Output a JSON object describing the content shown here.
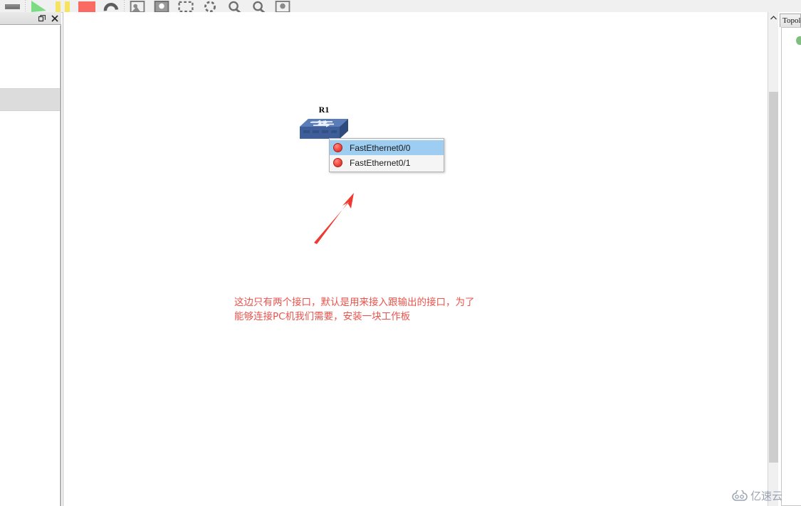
{
  "toolbar": {
    "buttons": [
      {
        "name": "minimize-icon",
        "icon": "minus-icon"
      },
      {
        "name": "start-button",
        "icon": "play-icon",
        "color": "#7ddb84"
      },
      {
        "name": "pause-button",
        "icon": "pause-icon",
        "color": "#f7e45e"
      },
      {
        "name": "stop-button",
        "icon": "stop-icon",
        "color": "#f96b62"
      },
      {
        "name": "reload-button",
        "icon": "reload-icon",
        "color": "#5d5d5d"
      },
      {
        "name": "screenshot-button",
        "icon": "image-icon"
      },
      {
        "name": "capture-button",
        "icon": "camera-icon"
      },
      {
        "name": "select-region-button",
        "icon": "dashed-rect-icon"
      },
      {
        "name": "lasso-button",
        "icon": "dashed-circle-icon"
      },
      {
        "name": "zoom-in-button",
        "icon": "magnifier-plus-icon"
      },
      {
        "name": "zoom-out-button",
        "icon": "magnifier-minus-icon"
      },
      {
        "name": "save-image-button",
        "icon": "save-image-icon"
      }
    ]
  },
  "left_panel": {
    "float_label": "❐",
    "close_label": "✕"
  },
  "canvas": {
    "device": {
      "label": "R1",
      "type": "router"
    },
    "context_menu": {
      "items": [
        {
          "label": "FastEthernet0/0",
          "selected": true,
          "status_color": "#f4534a"
        },
        {
          "label": "FastEthernet0/1",
          "selected": false,
          "status_color": "#f4534a"
        }
      ]
    },
    "annotation": {
      "arrow_color": "#ee3a30",
      "note_color": "#e8534c",
      "note_text": "这边只有两个接口，默认是用来接入跟输出的接口，为了\n能够连接PC机我们需要，安装一块工作板"
    }
  },
  "scrollbar": {
    "up_arrow": "︿"
  },
  "right_panel": {
    "tab_label": "Topol"
  },
  "watermark": {
    "text": "亿速云"
  }
}
